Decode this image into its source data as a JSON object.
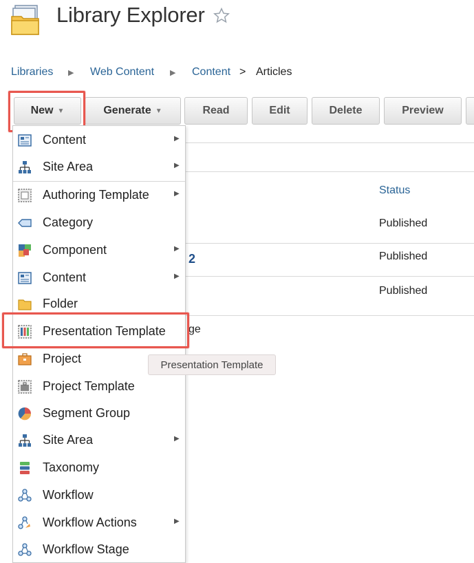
{
  "header": {
    "title": "Library Explorer",
    "favorite_icon": "star-outline-icon",
    "app_icon": "library-folder-icon"
  },
  "breadcrumb": {
    "items": [
      {
        "label": "Libraries",
        "link": true
      },
      {
        "label": "Web Content",
        "link": true
      },
      {
        "label": "Content",
        "link": true
      },
      {
        "label": "Articles",
        "link": false
      }
    ],
    "separator_final": ">"
  },
  "toolbar": {
    "new_label": "New",
    "generate_label": "Generate",
    "read_label": "Read",
    "edit_label": "Edit",
    "delete_label": "Delete",
    "preview_label": "Preview"
  },
  "table": {
    "status_header": "Status",
    "rows": [
      {
        "status": "Published"
      },
      {
        "status": "Published"
      },
      {
        "status": "Published"
      }
    ],
    "peek_number": "2",
    "peek_text": "ge"
  },
  "menu": {
    "items": [
      {
        "label": "Content",
        "icon": "content-icon",
        "submenu": true
      },
      {
        "label": "Site Area",
        "icon": "site-area-icon",
        "submenu": true
      },
      {
        "label": "Authoring Template",
        "icon": "authoring-template-icon",
        "submenu": true
      },
      {
        "label": "Category",
        "icon": "category-tag-icon",
        "submenu": false
      },
      {
        "label": "Component",
        "icon": "component-icon",
        "submenu": true
      },
      {
        "label": "Content",
        "icon": "content-icon",
        "submenu": true
      },
      {
        "label": "Folder",
        "icon": "folder-icon",
        "submenu": false
      },
      {
        "label": "Presentation Template",
        "icon": "presentation-template-icon",
        "submenu": false
      },
      {
        "label": "Project",
        "icon": "project-icon",
        "submenu": false
      },
      {
        "label": "Project Template",
        "icon": "project-template-icon",
        "submenu": false
      },
      {
        "label": "Segment Group",
        "icon": "segment-group-icon",
        "submenu": false
      },
      {
        "label": "Site Area",
        "icon": "site-area-icon",
        "submenu": true
      },
      {
        "label": "Taxonomy",
        "icon": "taxonomy-icon",
        "submenu": false
      },
      {
        "label": "Workflow",
        "icon": "workflow-icon",
        "submenu": false
      },
      {
        "label": "Workflow Actions",
        "icon": "workflow-actions-icon",
        "submenu": true
      },
      {
        "label": "Workflow Stage",
        "icon": "workflow-stage-icon",
        "submenu": false
      }
    ]
  },
  "tooltip": {
    "text": "Presentation Template"
  },
  "colors": {
    "highlight": "#e8574f",
    "link": "#2a6496"
  }
}
